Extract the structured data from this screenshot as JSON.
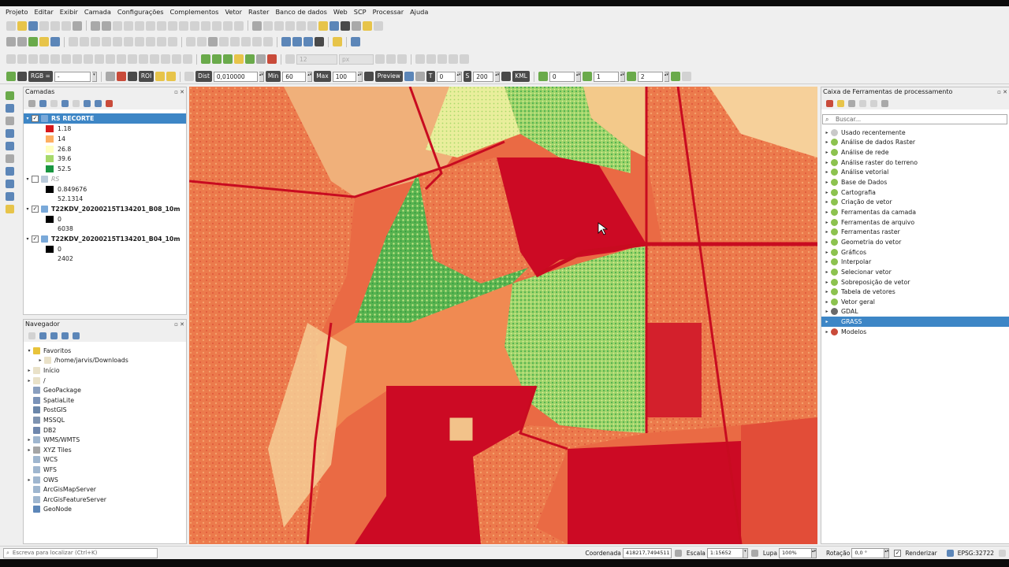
{
  "menu": [
    "Projeto",
    "Editar",
    "Exibir",
    "Camada",
    "Configurações",
    "Complementos",
    "Vetor",
    "Raster",
    "Banco de dados",
    "Web",
    "SCP",
    "Processar",
    "Ajuda"
  ],
  "scp_toolbar": {
    "rgb_label": "RGB =",
    "rgb_value": "-",
    "roi_label": "ROI",
    "dist_label": "Dist",
    "dist_value": "0,010000",
    "min_label": "Min",
    "min_value": "60",
    "max_label": "Max",
    "max_value": "100",
    "preview_label": "Preview",
    "t_label": "T",
    "t_value": "0",
    "s_label": "S",
    "s_value": "200",
    "kml_label": "KML",
    "v1": "0",
    "v2": "1",
    "v3": "2",
    "px_placeholder": "px",
    "disabled_value": "12"
  },
  "layers_panel": {
    "title": "Camadas",
    "layers": [
      {
        "name": "RS RECORTE",
        "checked": true,
        "legend": [
          {
            "value": "1.18",
            "color": "#d7191c"
          },
          {
            "value": "14",
            "color": "#fdae61"
          },
          {
            "value": "26.8",
            "color": "#ffffbf"
          },
          {
            "value": "39.6",
            "color": "#a6d96a"
          },
          {
            "value": "52.5",
            "color": "#1a9641"
          }
        ]
      },
      {
        "name": "RS",
        "checked": false,
        "legend_min": "0.849676",
        "legend_max": "52.1314"
      },
      {
        "name": "T22KDV_20200215T134201_B08_10m",
        "checked": true,
        "legend_min": "0",
        "legend_max": "6038"
      },
      {
        "name": "T22KDV_20200215T134201_B04_10m",
        "checked": true,
        "legend_min": "0",
        "legend_max": "2402"
      }
    ]
  },
  "browser_panel": {
    "title": "Navegador",
    "items": [
      {
        "label": "Favoritos",
        "icon": "star-icon",
        "indent": 0,
        "arrow": "▾"
      },
      {
        "label": "/home/jarvis/Downloads",
        "icon": "folder-icon",
        "indent": 1,
        "arrow": "▸"
      },
      {
        "label": "Início",
        "icon": "folder-icon",
        "indent": 0,
        "arrow": "▸"
      },
      {
        "label": "/",
        "icon": "folder-icon",
        "indent": 0,
        "arrow": "▸"
      },
      {
        "label": "GeoPackage",
        "icon": "geopackage-icon",
        "indent": 0,
        "arrow": ""
      },
      {
        "label": "SpatiaLite",
        "icon": "spatialite-icon",
        "indent": 0,
        "arrow": ""
      },
      {
        "label": "PostGIS",
        "icon": "postgis-icon",
        "indent": 0,
        "arrow": ""
      },
      {
        "label": "MSSQL",
        "icon": "mssql-icon",
        "indent": 0,
        "arrow": ""
      },
      {
        "label": "DB2",
        "icon": "db2-icon",
        "indent": 0,
        "arrow": ""
      },
      {
        "label": "WMS/WMTS",
        "icon": "globe-icon",
        "indent": 0,
        "arrow": "▸"
      },
      {
        "label": "XYZ Tiles",
        "icon": "grid-icon",
        "indent": 0,
        "arrow": "▸"
      },
      {
        "label": "WCS",
        "icon": "globe-icon",
        "indent": 0,
        "arrow": ""
      },
      {
        "label": "WFS",
        "icon": "globe-icon",
        "indent": 0,
        "arrow": ""
      },
      {
        "label": "OWS",
        "icon": "globe-icon",
        "indent": 0,
        "arrow": "▸"
      },
      {
        "label": "ArcGisMapServer",
        "icon": "globe-icon",
        "indent": 0,
        "arrow": ""
      },
      {
        "label": "ArcGisFeatureServer",
        "icon": "globe-icon",
        "indent": 0,
        "arrow": ""
      },
      {
        "label": "GeoNode",
        "icon": "geonode-icon",
        "indent": 0,
        "arrow": ""
      }
    ]
  },
  "toolbox_panel": {
    "title": "Caixa de Ferramentas de processamento",
    "search_placeholder": "Buscar...",
    "items": [
      {
        "label": "Usado recentemente",
        "icon": "clock-icon",
        "selected": false
      },
      {
        "label": "Análise de dados Raster",
        "icon": "qgis-icon",
        "selected": false
      },
      {
        "label": "Análise de rede",
        "icon": "qgis-icon",
        "selected": false
      },
      {
        "label": "Análise raster do terreno",
        "icon": "qgis-icon",
        "selected": false
      },
      {
        "label": "Análise vetorial",
        "icon": "qgis-icon",
        "selected": false
      },
      {
        "label": "Base de Dados",
        "icon": "qgis-icon",
        "selected": false
      },
      {
        "label": "Cartografia",
        "icon": "qgis-icon",
        "selected": false
      },
      {
        "label": "Criação de vetor",
        "icon": "qgis-icon",
        "selected": false
      },
      {
        "label": "Ferramentas da camada",
        "icon": "qgis-icon",
        "selected": false
      },
      {
        "label": "Ferramentas de arquivo",
        "icon": "qgis-icon",
        "selected": false
      },
      {
        "label": "Ferramentas raster",
        "icon": "qgis-icon",
        "selected": false
      },
      {
        "label": "Geometria do vetor",
        "icon": "qgis-icon",
        "selected": false
      },
      {
        "label": "Gráficos",
        "icon": "qgis-icon",
        "selected": false
      },
      {
        "label": "Interpolar",
        "icon": "qgis-icon",
        "selected": false
      },
      {
        "label": "Selecionar vetor",
        "icon": "qgis-icon",
        "selected": false
      },
      {
        "label": "Sobreposição de vetor",
        "icon": "qgis-icon",
        "selected": false
      },
      {
        "label": "Tabela de vetores",
        "icon": "qgis-icon",
        "selected": false
      },
      {
        "label": "Vetor geral",
        "icon": "qgis-icon",
        "selected": false
      },
      {
        "label": "GDAL",
        "icon": "gdal-icon",
        "selected": false
      },
      {
        "label": "GRASS",
        "icon": "grass-icon",
        "selected": true
      },
      {
        "label": "Modelos",
        "icon": "models-icon",
        "selected": false
      }
    ]
  },
  "status": {
    "locate_placeholder": "Escreva para localizar (Ctrl+K)",
    "coord_label": "Coordenada",
    "coord_value": "418217,7494511",
    "scale_label": "Escala",
    "scale_value": "1:15652",
    "zoom_label": "Lupa",
    "zoom_value": "100%",
    "rotation_label": "Rotação",
    "rotation_value": "0,0 °",
    "render_label": "Renderizar",
    "crs": "EPSG:32722"
  },
  "colors": {
    "selection": "#3d86c6",
    "ndvi_low": "#d7191c",
    "ndvi_mid": "#ffffbf",
    "ndvi_high": "#1a9641"
  }
}
